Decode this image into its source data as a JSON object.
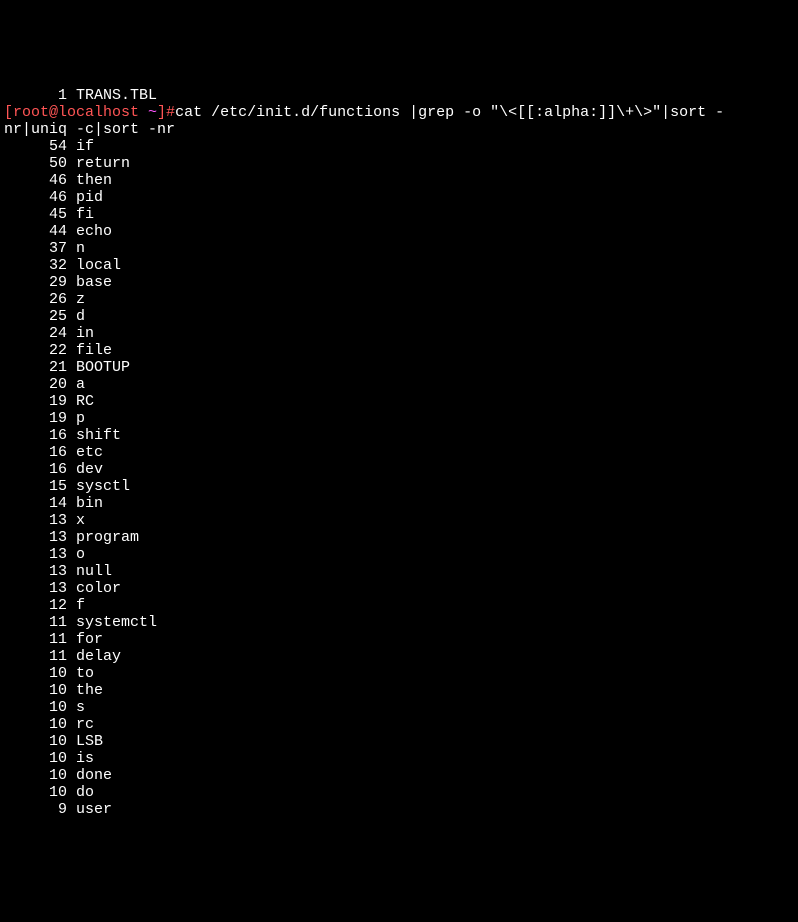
{
  "first_line": "      1 TRANS.TBL",
  "prompt_user_host": "[root@localhost ",
  "prompt_tilde": "~",
  "prompt_end": "]#",
  "command_part1": "cat /etc/init.d/functions |grep -o \"\\<[[:alpha:]]\\+\\>\"|sort -",
  "command_part2": "nr|uniq -c|sort -nr",
  "results": [
    {
      "count": "54",
      "word": "if"
    },
    {
      "count": "50",
      "word": "return"
    },
    {
      "count": "46",
      "word": "then"
    },
    {
      "count": "46",
      "word": "pid"
    },
    {
      "count": "45",
      "word": "fi"
    },
    {
      "count": "44",
      "word": "echo"
    },
    {
      "count": "37",
      "word": "n"
    },
    {
      "count": "32",
      "word": "local"
    },
    {
      "count": "29",
      "word": "base"
    },
    {
      "count": "26",
      "word": "z"
    },
    {
      "count": "25",
      "word": "d"
    },
    {
      "count": "24",
      "word": "in"
    },
    {
      "count": "22",
      "word": "file"
    },
    {
      "count": "21",
      "word": "BOOTUP"
    },
    {
      "count": "20",
      "word": "a"
    },
    {
      "count": "19",
      "word": "RC"
    },
    {
      "count": "19",
      "word": "p"
    },
    {
      "count": "16",
      "word": "shift"
    },
    {
      "count": "16",
      "word": "etc"
    },
    {
      "count": "16",
      "word": "dev"
    },
    {
      "count": "15",
      "word": "sysctl"
    },
    {
      "count": "14",
      "word": "bin"
    },
    {
      "count": "13",
      "word": "x"
    },
    {
      "count": "13",
      "word": "program"
    },
    {
      "count": "13",
      "word": "o"
    },
    {
      "count": "13",
      "word": "null"
    },
    {
      "count": "13",
      "word": "color"
    },
    {
      "count": "12",
      "word": "f"
    },
    {
      "count": "11",
      "word": "systemctl"
    },
    {
      "count": "11",
      "word": "for"
    },
    {
      "count": "11",
      "word": "delay"
    },
    {
      "count": "10",
      "word": "to"
    },
    {
      "count": "10",
      "word": "the"
    },
    {
      "count": "10",
      "word": "s"
    },
    {
      "count": "10",
      "word": "rc"
    },
    {
      "count": "10",
      "word": "LSB"
    },
    {
      "count": "10",
      "word": "is"
    },
    {
      "count": "10",
      "word": "done"
    },
    {
      "count": "10",
      "word": "do"
    },
    {
      "count": "9",
      "word": "user"
    }
  ]
}
